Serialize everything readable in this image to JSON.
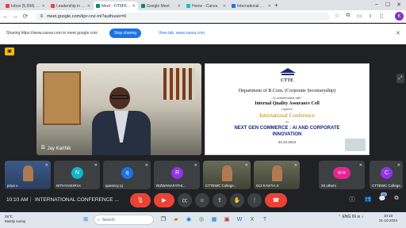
{
  "browser": {
    "tabs": [
      {
        "title": "Inbox (5,594) - ctcc...",
        "favicon_color": "#ea4335",
        "active": false
      },
      {
        "title": "Leadership in the v...",
        "favicon_color": "#ea4335",
        "active": false
      },
      {
        "title": "Meet - FIT8F6A...",
        "favicon_color": "#00897b",
        "active": true
      },
      {
        "title": "Google Meet",
        "favicon_color": "#00897b",
        "active": false
      },
      {
        "title": "Home - Canva",
        "favicon_color": "#00c4cc",
        "active": false
      },
      {
        "title": "International Co...",
        "favicon_color": "#1a73e8",
        "active": false
      }
    ],
    "new_tab_icon": "+",
    "url": "meet.google.com/kpr-cnz-mi?authuser=0",
    "profile_initial": "K"
  },
  "sharing_bar": {
    "text": "Sharing https://www.canva.com to meet.google.com",
    "stop_label": "Stop sharing",
    "view_label": "View tab: www.canva.com"
  },
  "stage": {
    "speaker_name": "Jay Karthik",
    "slide": {
      "logo_text": "CTTE",
      "department": "Department of B.Com. (Corporate Secretaryship)",
      "collab": "in collaboration with",
      "cell": "Internal Quality Assurance Cell",
      "organizes": "organize",
      "conference": "International Conference",
      "on": "on",
      "theme_line1": "NEXT GEN COMMERCE : AI AND CORPORATE",
      "theme_line2": "INNOVATION",
      "date": "23.10.2024"
    }
  },
  "participants": [
    {
      "name": "priya u",
      "avatar": "",
      "color": "#5f6368",
      "has_video": true
    },
    {
      "name": "NITHYASHRI.K",
      "avatar": "N",
      "color": "#12b5cb",
      "has_video": false
    },
    {
      "name": "queency pj",
      "avatar": "q",
      "color": "#1a73e8",
      "has_video": false
    },
    {
      "name": "RIZWANAFATHI...",
      "avatar": "R",
      "color": "#9334e6",
      "has_video": false
    },
    {
      "name": "CTTEWC College...",
      "avatar": "",
      "color": "#5f6368",
      "has_video": true
    },
    {
      "name": "013 KAVIYA.S",
      "avatar": "",
      "color": "#5f6368",
      "has_video": true
    },
    {
      "name": "20 others",
      "avatar": "W R",
      "color": "#e52592",
      "has_video": false
    },
    {
      "name": "CTTEWC College...",
      "avatar": "C",
      "color": "#9334e6",
      "has_video": false
    }
  ],
  "meeting": {
    "time": "10:10 AM",
    "title": "INTERNATIONAL CONFERENCE ...",
    "participant_count": "26"
  },
  "taskbar": {
    "weather_temp": "28°C",
    "weather_desc": "Mostly sunny",
    "search_placeholder": "Search",
    "lang": "ENG IN",
    "time": "10:10",
    "date": "21-10-2024"
  }
}
